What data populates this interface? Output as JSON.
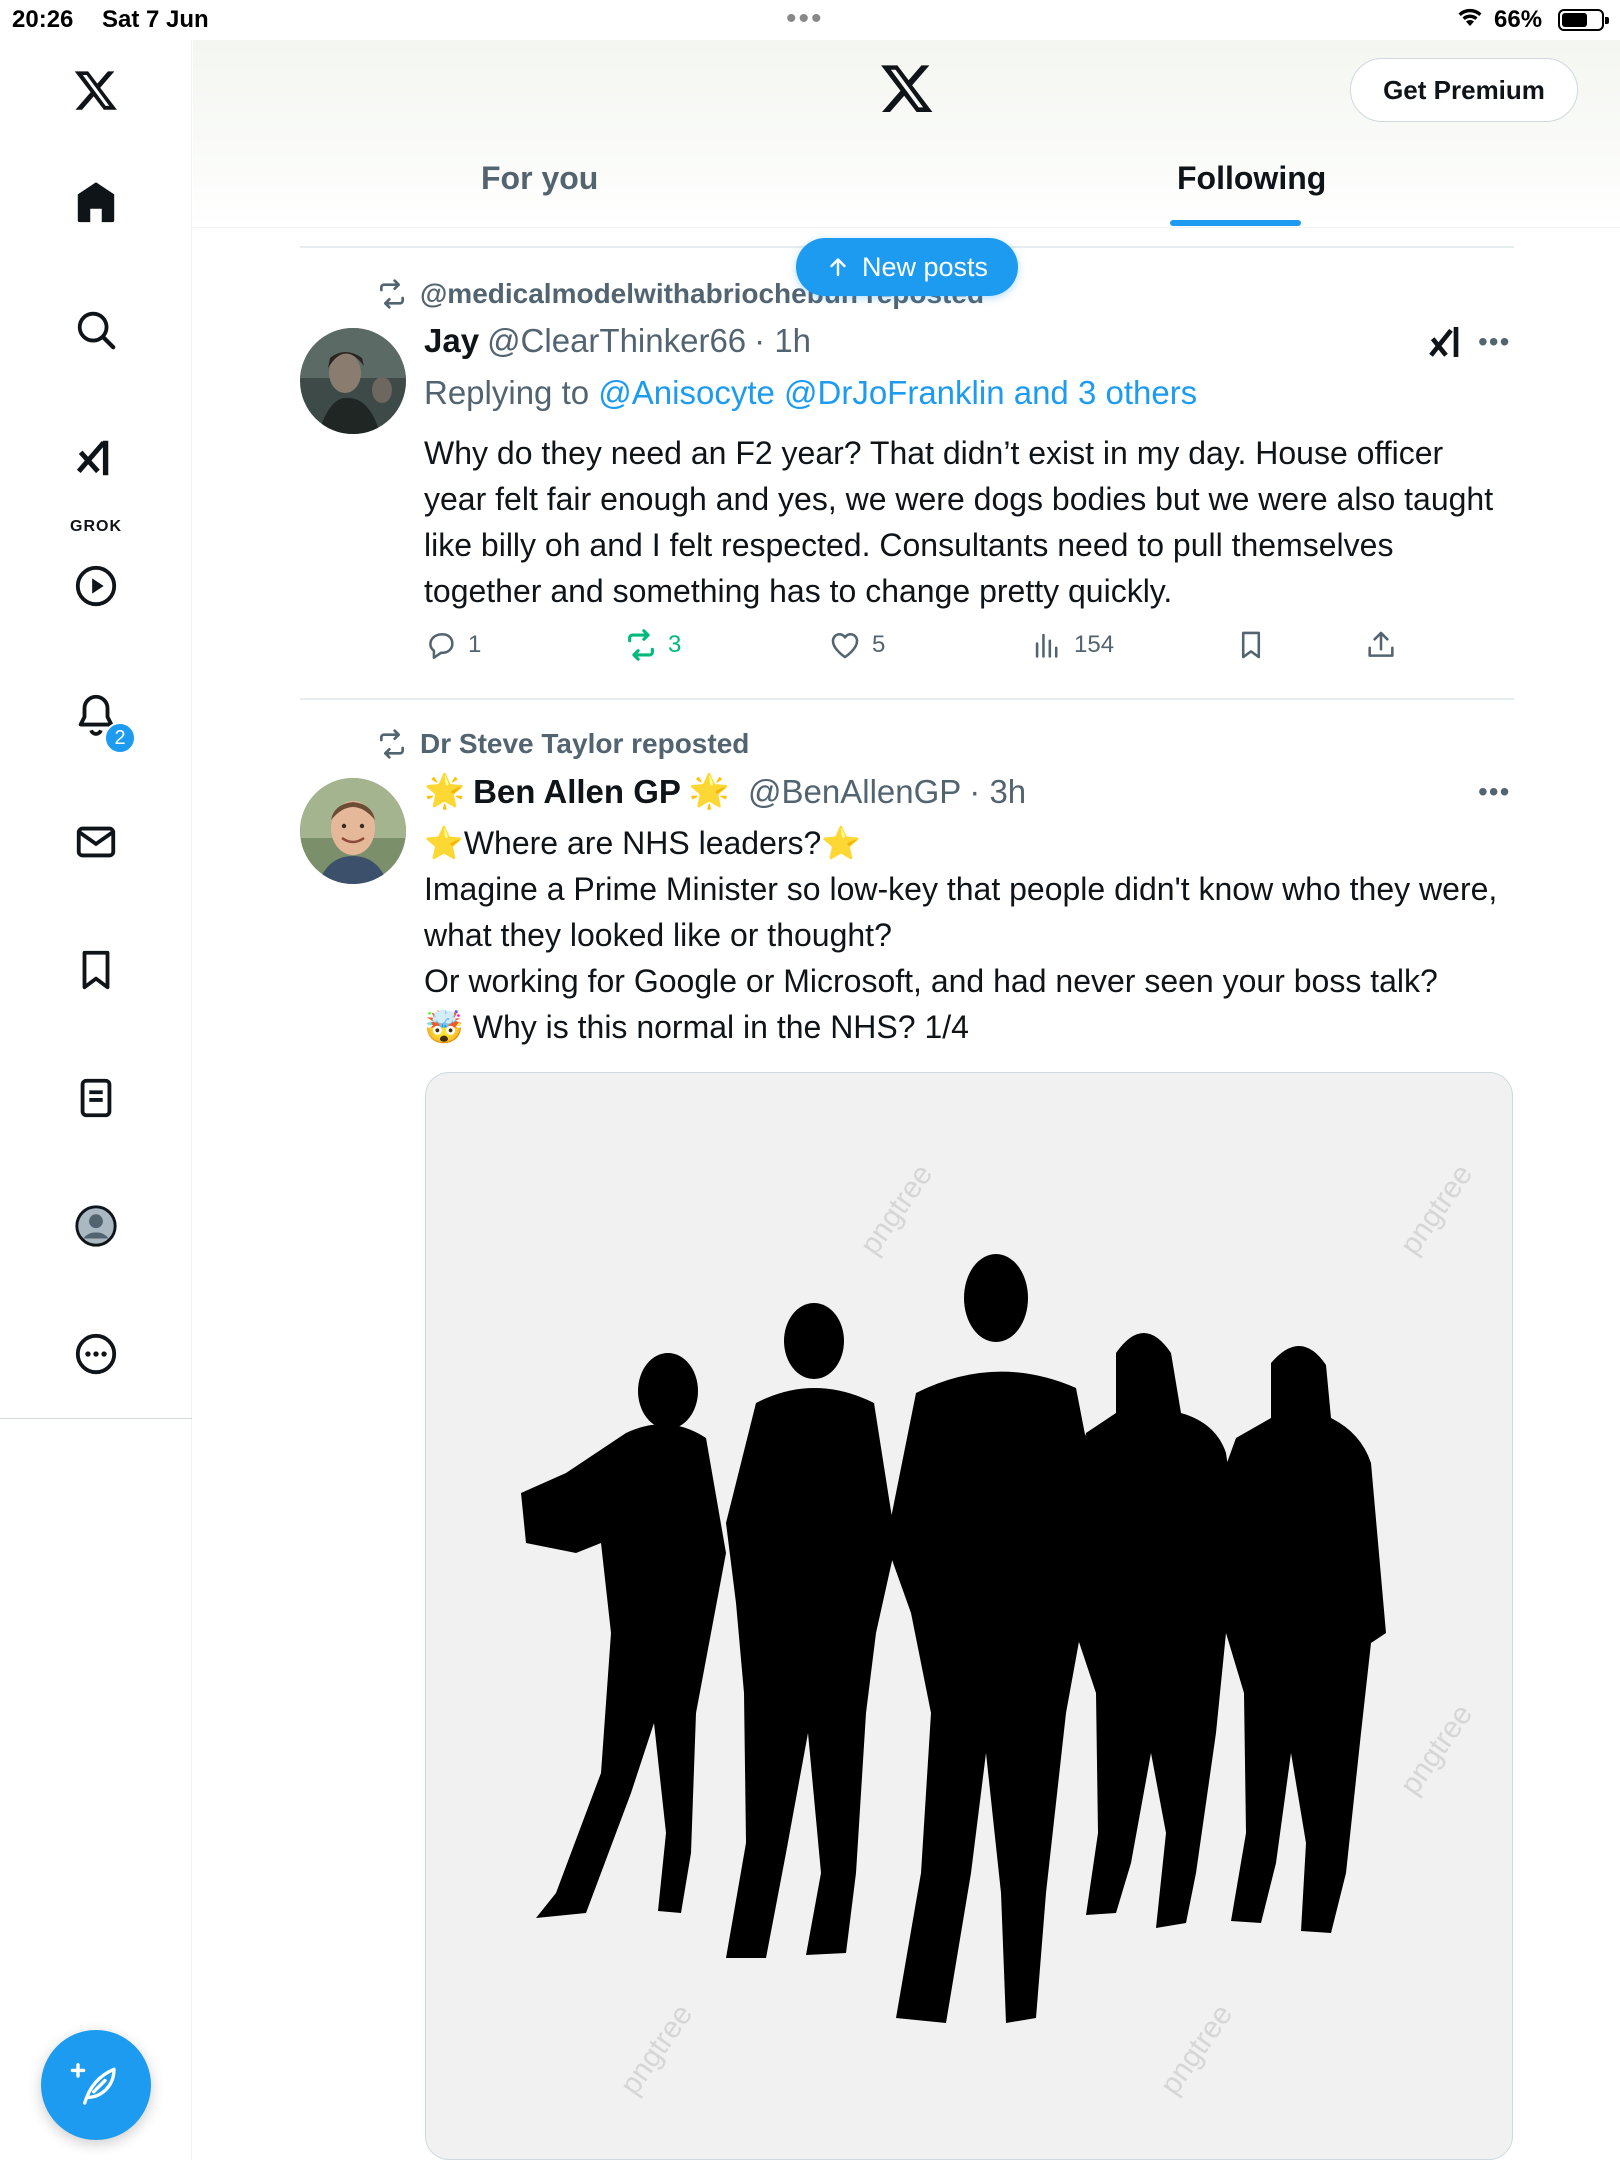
{
  "status": {
    "time": "20:26",
    "date": "Sat 7 Jun",
    "battery": "66%",
    "battery_level": 0.66
  },
  "header": {
    "premium_label": "Get Premium",
    "tabs": [
      {
        "label": "For you",
        "active": false
      },
      {
        "label": "Following",
        "active": true
      }
    ],
    "new_posts_label": "New posts"
  },
  "sidebar": {
    "items": [
      "home-icon",
      "search-icon",
      "grok-icon",
      "video-icon",
      "notifications-icon",
      "messages-icon",
      "bookmarks-icon",
      "lists-icon",
      "profile-icon",
      "more-icon"
    ],
    "grok_label": "GROK",
    "notification_count": "2"
  },
  "posts": [
    {
      "repost_by": "@medicalmodelwithabriochebun reposted",
      "name": "Jay",
      "handle": "@ClearThinker66",
      "time": "· 1h",
      "reply_prefix": "Replying to ",
      "reply_mentions": "@Anisocyte @DrJoFranklin and 3 others",
      "text": "Why do they need an F2 year? That didn’t exist in my day. House officer year felt fair enough and yes, we were dogs bodies but we were also taught like billy oh and I felt respected. Consultants need to pull themselves together and something has to change pretty quickly.",
      "replies": "1",
      "reposts": "3",
      "likes": "5",
      "views": "154"
    },
    {
      "repost_by": "Dr Steve Taylor reposted",
      "name_prefix": "🌟",
      "name": "Ben Allen GP",
      "name_suffix": "🌟",
      "handle": "@BenAllenGP",
      "time": "· 3h",
      "text_lines": [
        "⭐Where are NHS leaders?⭐",
        "Imagine a Prime Minister so low-key that people didn't know who they were, what they looked like or thought?",
        "Or working for Google or Microsoft, and had never seen your boss talk?",
        "🤯 Why is this normal in the NHS? 1/4"
      ],
      "media_watermark": "pngtree"
    }
  ],
  "colors": {
    "accent": "#1d9bf0",
    "repost_green": "#00ba7c",
    "muted": "#536471",
    "text": "#0f1419"
  }
}
